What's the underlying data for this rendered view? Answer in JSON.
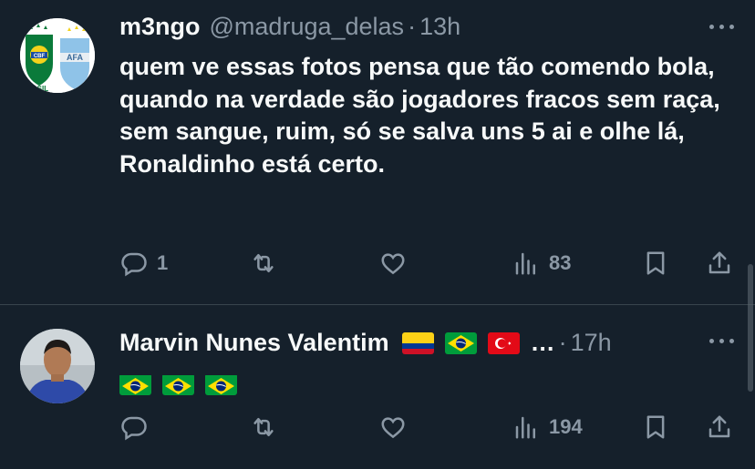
{
  "tweets": [
    {
      "name": "m3ngo",
      "handle": "@madruga_delas",
      "separator": "·",
      "time": "13h",
      "text": "quem ve essas fotos pensa que tão comendo bola, quando na verdade são jogadores fracos sem raça, sem sangue, ruim, só se salva uns 5 ai e olhe lá, Ronaldinho está certo.",
      "avatar_logo_text": "CBF",
      "avatar_logo_text2": "ASIL",
      "replies": "1",
      "likes": "",
      "views": "83"
    },
    {
      "name": "Marvin Nunes Valentim",
      "name_suffix": "…",
      "separator": "·",
      "time": "17h",
      "name_flags": [
        "colombia-flag",
        "brazil-flag",
        "turkey-flag"
      ],
      "body_flags": [
        "brazil-flag",
        "brazil-flag",
        "brazil-flag"
      ],
      "replies": "",
      "views": "194"
    }
  ],
  "colors": {
    "background": "#15202b",
    "text": "#f7f9f9",
    "muted": "#8b98a5",
    "divider": "#38444d"
  }
}
